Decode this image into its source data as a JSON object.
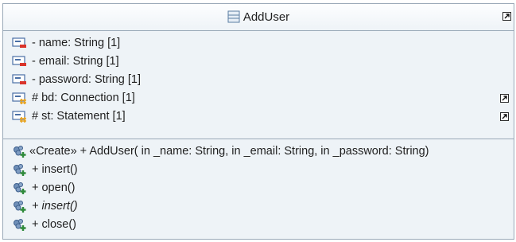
{
  "class_name": "AddUser",
  "attributes": [
    {
      "label": "- name: String [1]",
      "icon": "private-attribute-icon"
    },
    {
      "label": "- email: String [1]",
      "icon": "private-attribute-icon"
    },
    {
      "label": "- password: String [1]",
      "icon": "private-attribute-icon"
    },
    {
      "label": "# bd: Connection [1]",
      "icon": "protected-attribute-icon"
    },
    {
      "label": "# st: Statement [1]",
      "icon": "protected-attribute-icon"
    }
  ],
  "operations": [
    {
      "label": "«Create»  + AddUser(  in _name: String,   in _email: String,   in _password: String)",
      "italic": false
    },
    {
      "label": "+ insert()",
      "italic": false
    },
    {
      "label": "+ open()",
      "italic": false
    },
    {
      "label": "+ insert()",
      "italic": true
    },
    {
      "label": "+ close()",
      "italic": false
    }
  ],
  "colors": {
    "border": "#9aa9b8",
    "compartment": "#eef3f7",
    "private": "#d9342b",
    "protected": "#e8a21c",
    "operation": "#2f8a3b"
  }
}
